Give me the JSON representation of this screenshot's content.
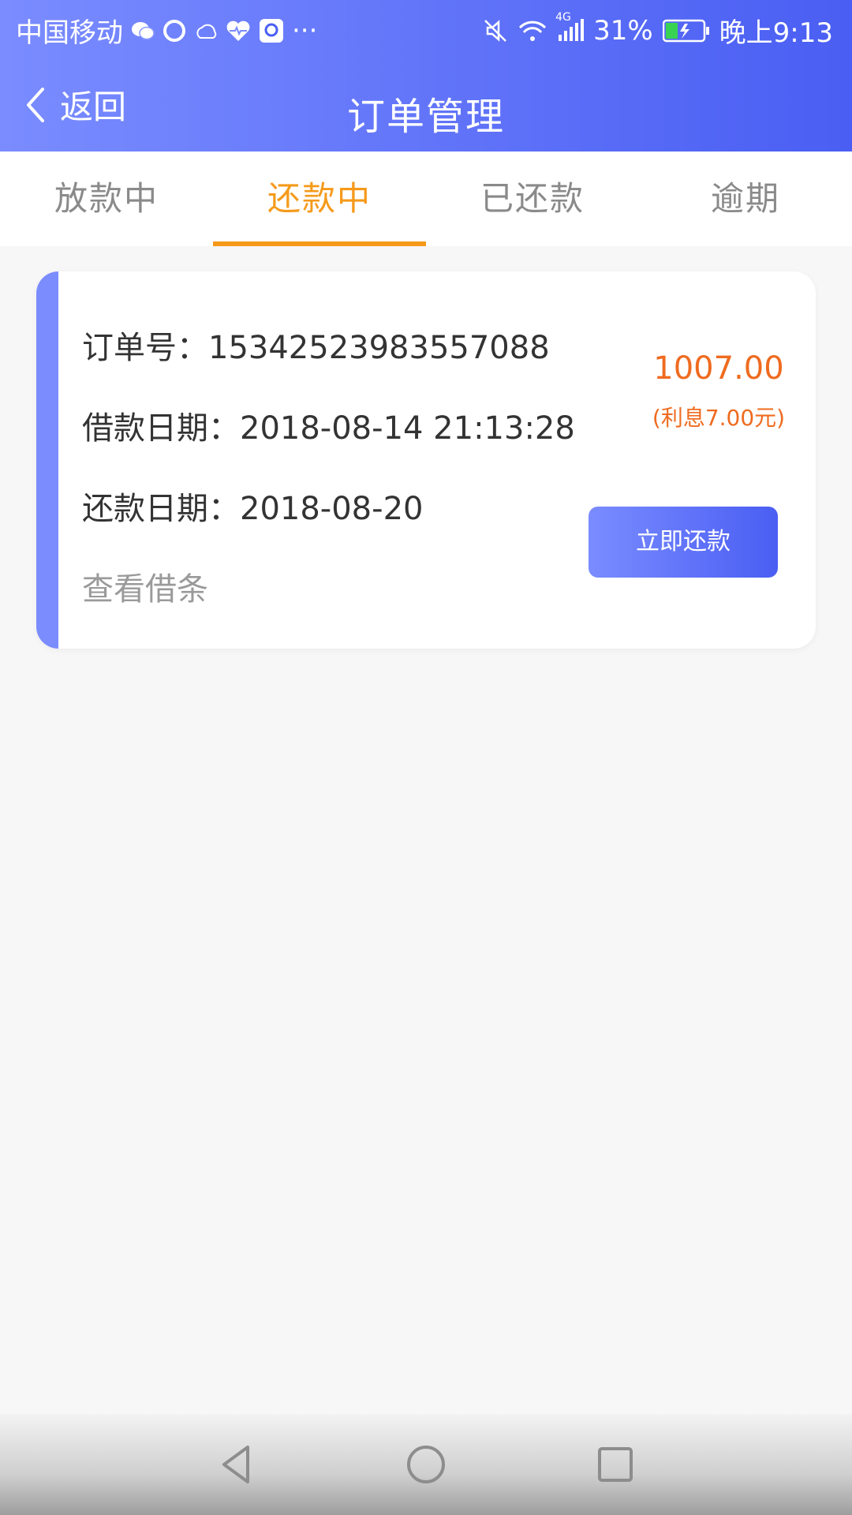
{
  "status_bar": {
    "carrier": "中国移动",
    "battery": "31%",
    "time": "晚上9:13",
    "network": "4G",
    "more": "···",
    "icons": [
      "wechat-icon",
      "browser-icon",
      "weather-icon",
      "health-icon",
      "app-icon",
      "more-icon",
      "mute-icon",
      "wifi-icon",
      "signal-icon",
      "battery-icon"
    ]
  },
  "nav": {
    "back_label": "返回",
    "title": "订单管理"
  },
  "tabs": [
    {
      "label": "放款中",
      "active": false
    },
    {
      "label": "还款中",
      "active": true
    },
    {
      "label": "已还款",
      "active": false
    },
    {
      "label": "逾期",
      "active": false
    }
  ],
  "order": {
    "order_no_label": "订单号：",
    "order_no": "15342523983557088",
    "loan_date_label": "借款日期：",
    "loan_date": "2018-08-14 21:13:28",
    "repay_date_label": "还款日期：",
    "repay_date": "2018-08-20",
    "view_note_label": "查看借条",
    "amount": "1007.00",
    "interest": "(利息7.00元)",
    "pay_button": "立即还款"
  },
  "colors": {
    "header_start": "#7a8cff",
    "header_end": "#4a5ef3",
    "active_tab": "#f59a1a",
    "amount": "#ef6b1f"
  }
}
